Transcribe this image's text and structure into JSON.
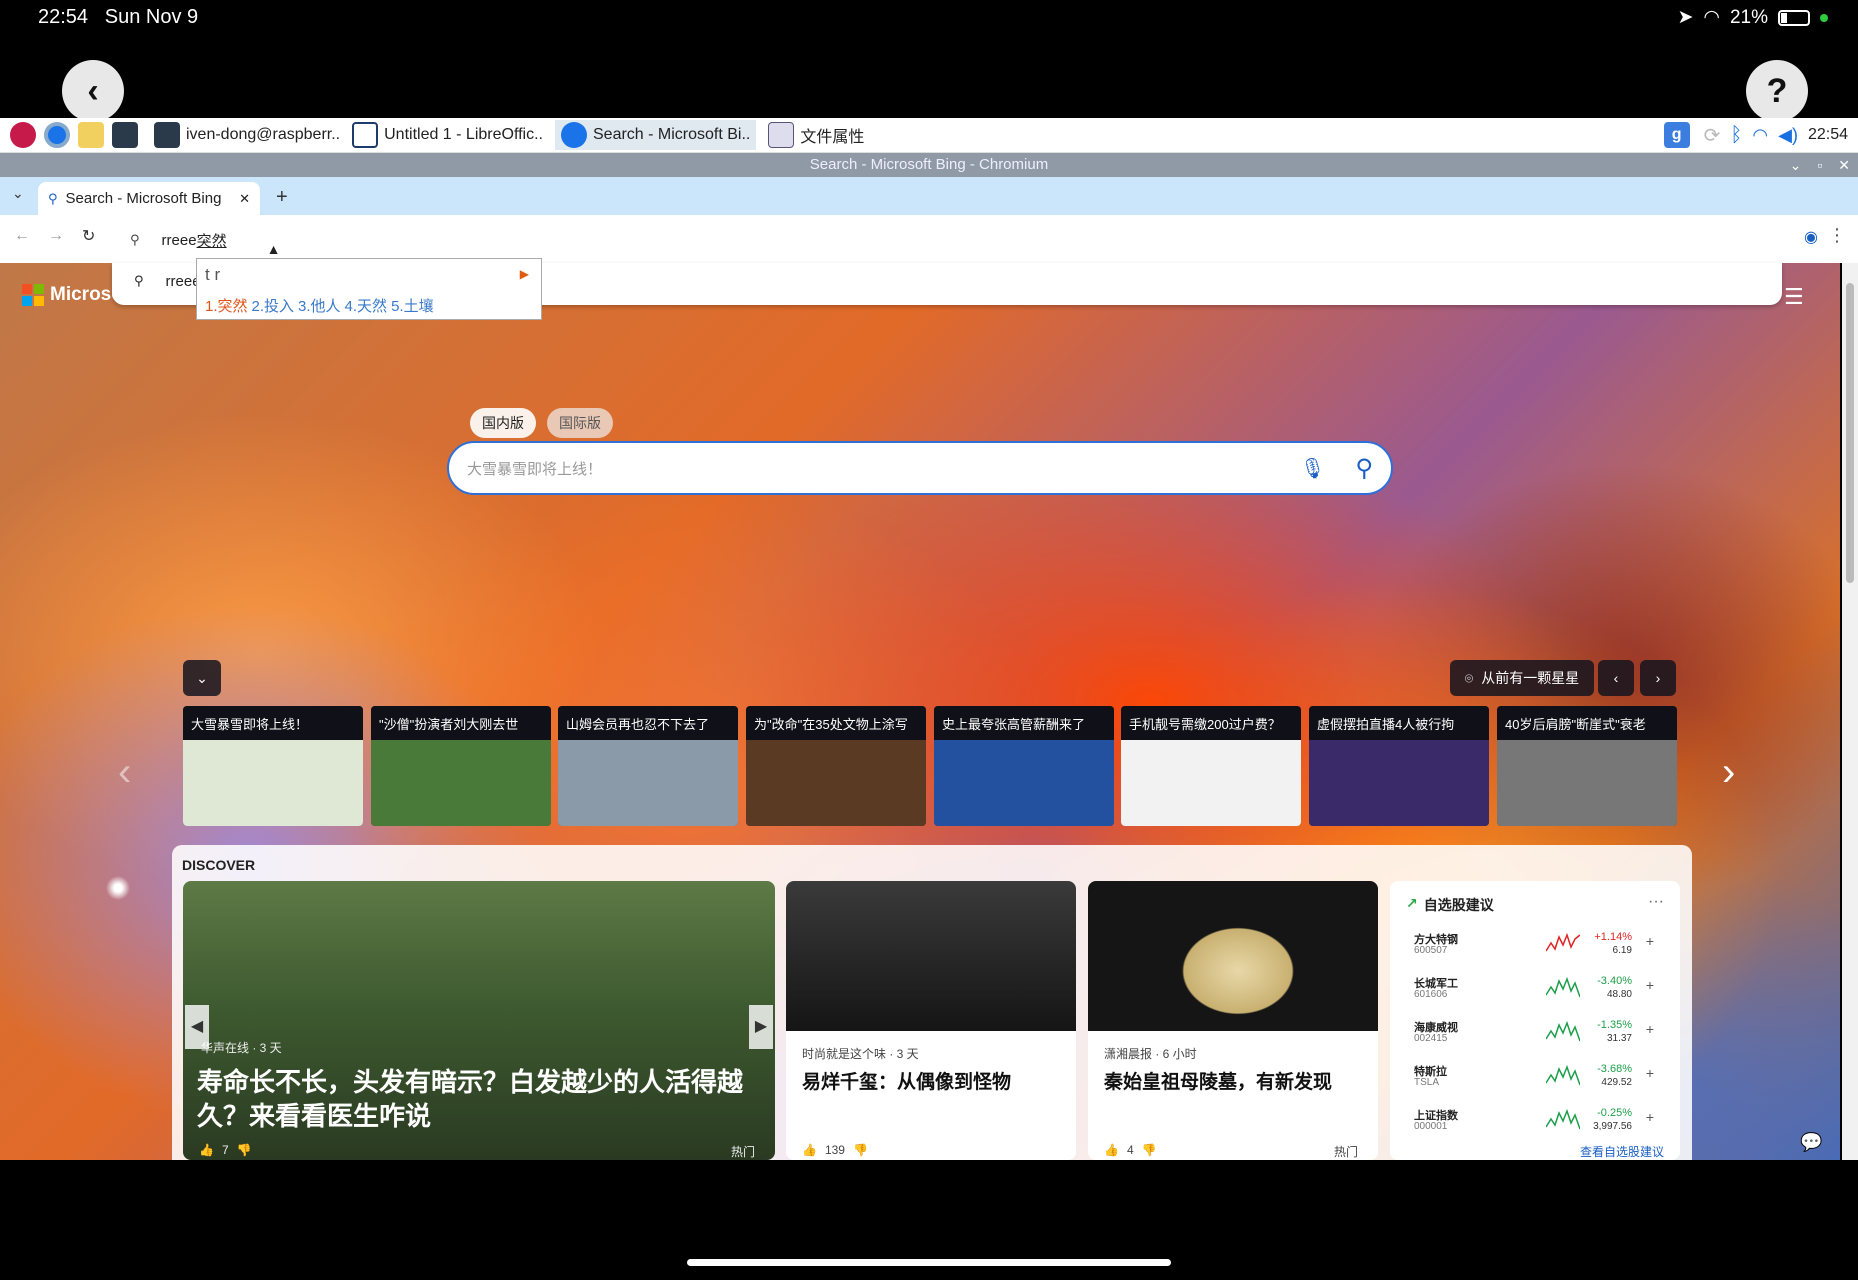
{
  "ios": {
    "time": "22:54",
    "date": "Sun Nov 9",
    "battery": "21%"
  },
  "taskbar": {
    "items": [
      "iven-dong@raspberr..",
      "Untitled 1 - LibreOffic..",
      "Search - Microsoft Bi..",
      "文件属性"
    ],
    "clock": "22:54"
  },
  "window": {
    "title": "Search - Microsoft Bing - Chromium"
  },
  "browser": {
    "tab_title": "Search - Microsoft Bing",
    "omnibox_text": "rreee",
    "omnibox_composing": "突然",
    "suggestion_text": "rreee"
  },
  "ime": {
    "input": "t r",
    "candidates": [
      "1.突然",
      "2.投入",
      "3.他人",
      "4.天然",
      "5.土壤"
    ]
  },
  "bing": {
    "logo": "Microso",
    "region_tabs": [
      "国内版",
      "国际版"
    ],
    "search_placeholder": "大雪暴雪即将上线！",
    "image_info": "从前有一颗星星"
  },
  "news": [
    {
      "title": "大雪暴雪即将上线！",
      "color": "#dfe8d4"
    },
    {
      "title": "\"沙僧\"扮演者刘大刚去世",
      "color": "#4a7a3a"
    },
    {
      "title": "山姆会员再也忍不下去了",
      "color": "#8a9aa8"
    },
    {
      "title": "为\"改命\"在35处文物上涂写",
      "color": "#5a3a22"
    },
    {
      "title": "史上最夸张高管薪酬来了",
      "color": "#2450a0"
    },
    {
      "title": "手机靓号需缴200过户费？",
      "color": "#f2f2f2"
    },
    {
      "title": "虚假摆拍直播4人被行拘",
      "color": "#3a2a6a"
    },
    {
      "title": "40岁后肩膀\"断崖式\"衰老",
      "color": "#777777"
    }
  ],
  "discover": {
    "label": "DISCOVER",
    "main": {
      "source": "华声在线 · 3 天",
      "headline": "寿命长不长，头发有暗示？白发越少的人活得越久？来看看医生咋说",
      "likes": "7",
      "tag": "热门"
    },
    "card2": {
      "source": "时尚就是这个味 · 3 天",
      "headline": "易烊千玺：从偶像到怪物",
      "likes": "139"
    },
    "card3": {
      "source": "潇湘晨报 · 6 小时",
      "headline": "秦始皇祖母陵墓，有新发现",
      "likes": "4",
      "tag": "热门"
    },
    "stocks": {
      "title": "自选股建议",
      "more": "···",
      "rows": [
        {
          "name": "方大特钢",
          "code": "600507",
          "change": "+1.14%",
          "price": "6.19",
          "up": true
        },
        {
          "name": "长城军工",
          "code": "601606",
          "change": "-3.40%",
          "price": "48.80",
          "up": false
        },
        {
          "name": "海康威视",
          "code": "002415",
          "change": "-1.35%",
          "price": "31.37",
          "up": false
        },
        {
          "name": "特斯拉",
          "code": "TSLA",
          "change": "-3.68%",
          "price": "429.52",
          "up": false
        },
        {
          "name": "上证指数",
          "code": "000001",
          "change": "-0.25%",
          "price": "3,997.56",
          "up": false
        }
      ],
      "link": "查看自选股建议"
    }
  }
}
